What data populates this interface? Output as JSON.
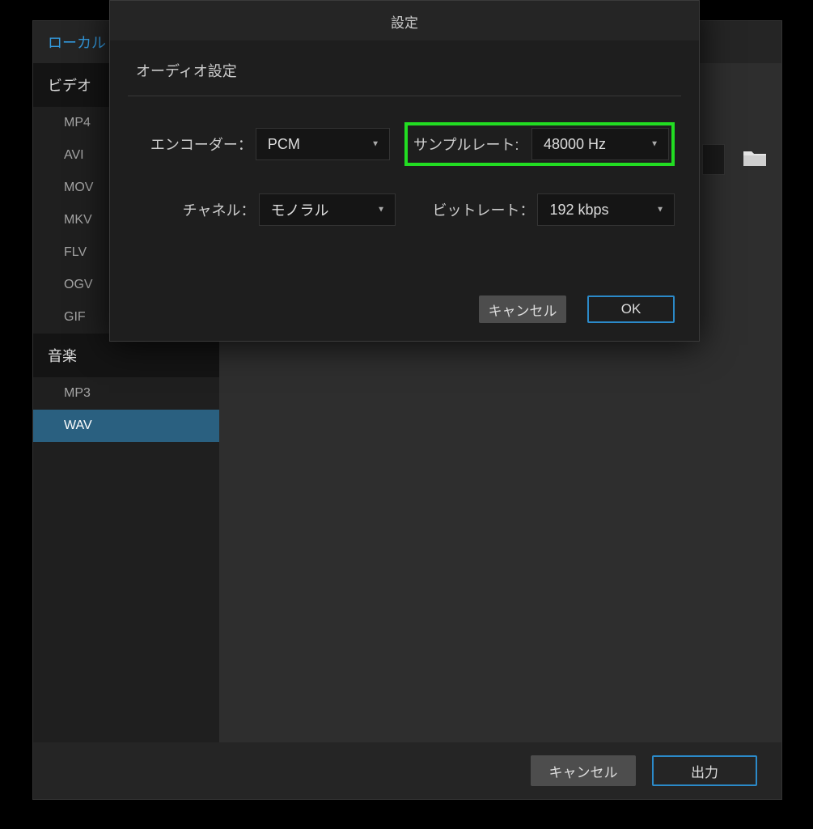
{
  "topTabs": {
    "local": "ローカル"
  },
  "sidebar": {
    "video_header": "ビデオ",
    "video_items": [
      "MP4",
      "AVI",
      "MOV",
      "MKV",
      "FLV",
      "OGV",
      "GIF"
    ],
    "music_header": "音楽",
    "music_items": [
      "MP3",
      "WAV"
    ],
    "selected": "WAV"
  },
  "bottomBar": {
    "cancel": "キャンセル",
    "output": "出力"
  },
  "modal": {
    "title": "設定",
    "subtitle": "オーディオ設定",
    "encoder_label": "エンコーダー：",
    "encoder_value": "PCM",
    "sample_rate_label": "サンプルレート:",
    "sample_rate_value": "48000 Hz",
    "channel_label": "チャネル：",
    "channel_value": "モノラル",
    "bitrate_label": "ビットレート：",
    "bitrate_value": "192 kbps",
    "cancel": "キャンセル",
    "ok": "OK"
  }
}
